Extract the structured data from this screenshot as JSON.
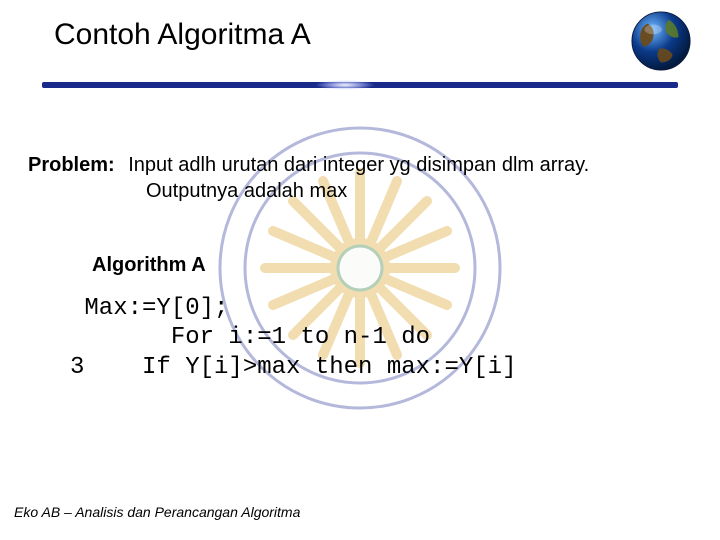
{
  "header": {
    "title": "Contoh Algoritma A"
  },
  "body": {
    "problem_label": "Problem:",
    "problem_text_1": "Input adlh urutan dari integer yg disimpan dlm array.",
    "problem_text_2": "Outputnya adalah max",
    "algorithm_label": "Algorithm A",
    "code_line_1": " Max:=Y[0];",
    "code_line_2": "       For i:=1 to n-1 do",
    "code_line_3": "3    If Y[i]>max then max:=Y[i]"
  },
  "footer": {
    "text": "Eko AB – Analisis dan Perancangan Algoritma"
  }
}
